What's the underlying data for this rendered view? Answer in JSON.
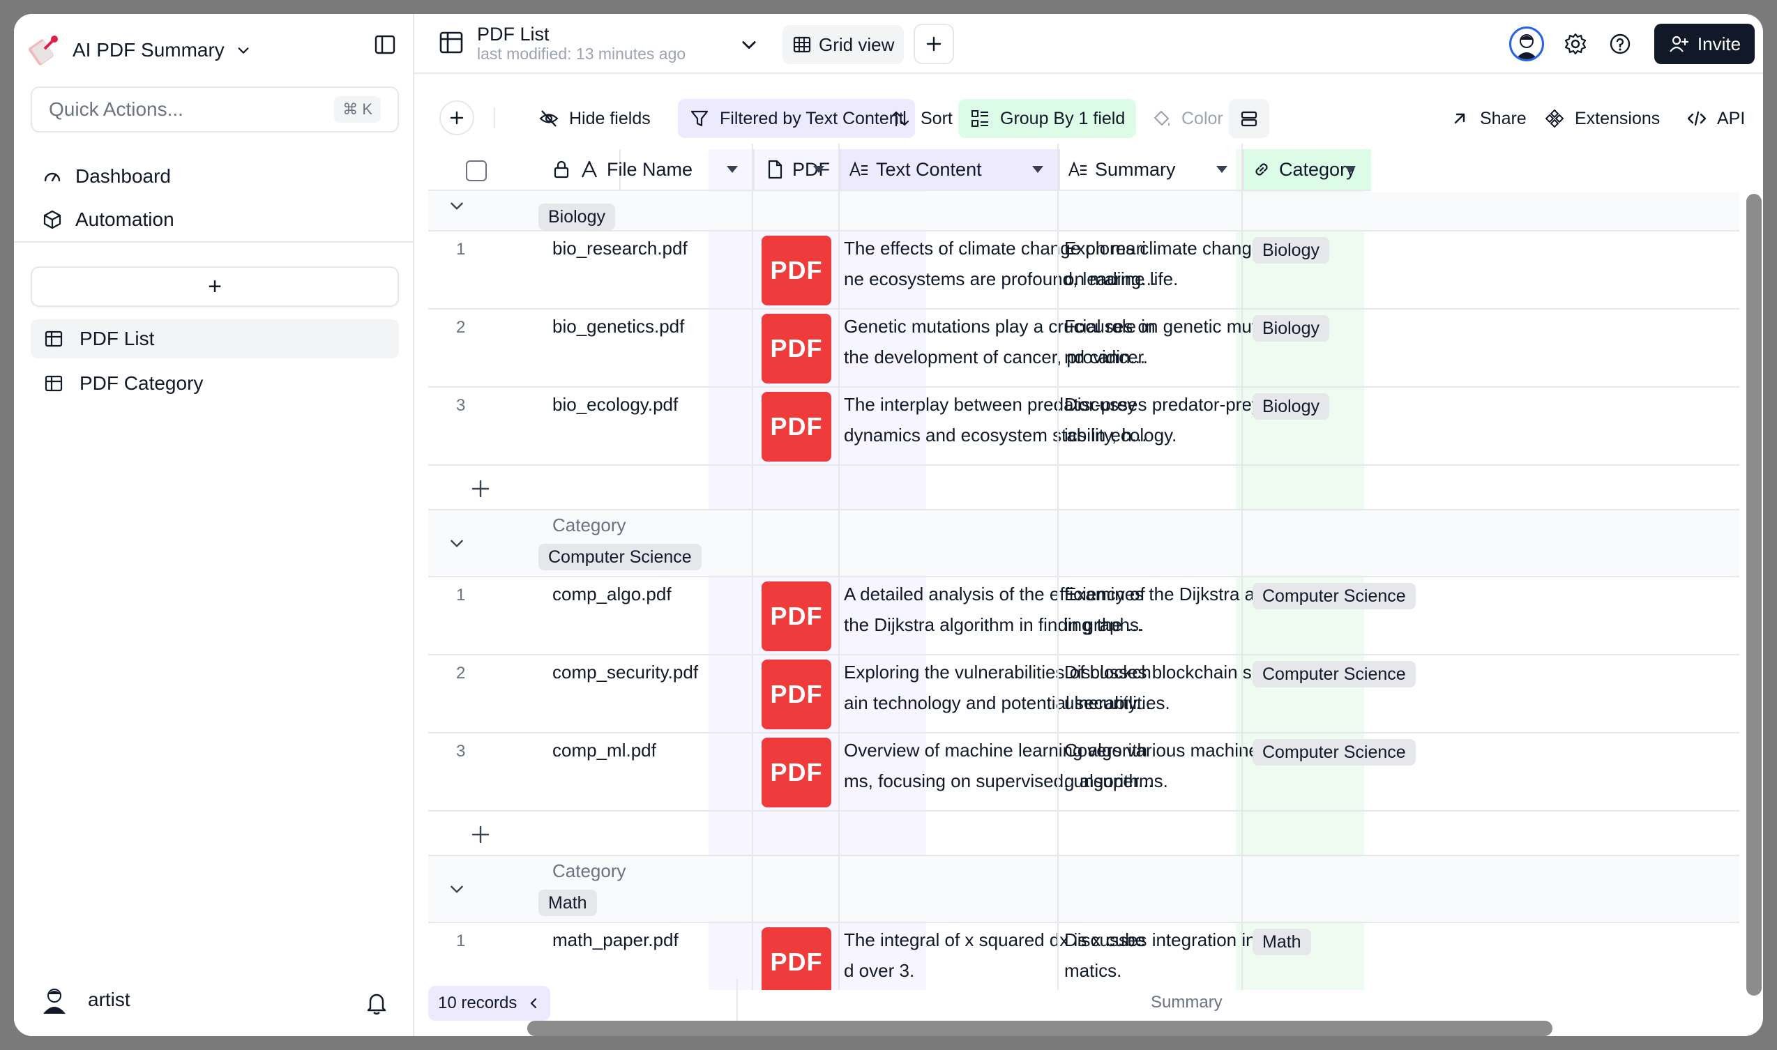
{
  "sidebar": {
    "app_title": "AI PDF Summary",
    "quick_actions_placeholder": "Quick Actions...",
    "quick_actions_shortcut": "⌘ K",
    "nav": [
      {
        "label": "Dashboard",
        "icon": "gauge-icon"
      },
      {
        "label": "Automation",
        "icon": "cube-icon"
      }
    ],
    "add_table_label": "+",
    "tables": [
      {
        "label": "PDF List",
        "active": true
      },
      {
        "label": "PDF Category",
        "active": false
      }
    ],
    "user_name": "artist"
  },
  "header": {
    "table_name": "PDF List",
    "last_modified": "last modified: 13 minutes ago",
    "view_name": "Grid view",
    "invite_label": "Invite"
  },
  "toolbar": {
    "hide_fields": "Hide fields",
    "filter": "Filtered by Text Content",
    "sort": "Sort",
    "group": "Group By 1 field",
    "color": "Color",
    "share": "Share",
    "extensions": "Extensions",
    "api": "API"
  },
  "columns": {
    "file_name": "File Name",
    "pdf": "PDF",
    "text_content": "Text Content",
    "summary": "Summary",
    "category": "Category"
  },
  "group_label": "Category",
  "pdf_thumb_text": "PDF",
  "groups": [
    {
      "name": "Biology",
      "rows": [
        {
          "n": "1",
          "file": "bio_research.pdf",
          "text1": "The effects of climate change on mari",
          "text2": "ne ecosystems are profound, leading...",
          "sum1": "Explores climate change impact",
          "sum2": "on marine life.",
          "cat": "Biology"
        },
        {
          "n": "2",
          "file": "bio_genetics.pdf",
          "text1": "Genetic mutations play a crucial role in",
          "text2": " the development of cancer, providin...",
          "sum1": "Focuses on genetic mutations a",
          "sum2": "nd cancer.",
          "cat": "Biology"
        },
        {
          "n": "3",
          "file": "bio_ecology.pdf",
          "text1": "The interplay between predator-prey",
          "text2": "dynamics and ecosystem stability, h...",
          "sum1": "Discusses predator-prey dynam",
          "sum2": "ics in ecology.",
          "cat": "Biology"
        }
      ]
    },
    {
      "name": "Computer Science",
      "rows": [
        {
          "n": "1",
          "file": "comp_algo.pdf",
          "text1": "A detailed analysis of the efficiency of",
          "text2": " the Dijkstra algorithm in finding the ...",
          "sum1": "Examines the Dijkstra algorithm",
          "sum2": "in graphs.",
          "cat": "Computer Science"
        },
        {
          "n": "2",
          "file": "comp_security.pdf",
          "text1": "Exploring the vulnerabilities of blockch",
          "text2": "ain technology and potential security...",
          "sum1": "Discusses blockchain security v",
          "sum2": "ulnerabilities.",
          "cat": "Computer Science"
        },
        {
          "n": "3",
          "file": "comp_ml.pdf",
          "text1": "Overview of machine learning algorith",
          "text2": "ms, focusing on supervised, unsuper...",
          "sum1": "Covers various machine learnin",
          "sum2": "g algorithms.",
          "cat": "Computer Science"
        }
      ]
    },
    {
      "name": "Math",
      "rows": [
        {
          "n": "1",
          "file": "math_paper.pdf",
          "text1": "The integral of x squared dx is x cube",
          "text2": "d over 3.",
          "sum1": "Discusses integration in mathe",
          "sum2": "matics.",
          "cat": "Math"
        }
      ]
    }
  ],
  "footer": {
    "records": "10 records",
    "summary_label": "Summary"
  },
  "colors": {
    "accent_violet": "#ede9fe",
    "accent_green": "#dcfce7",
    "pdf_red": "#ef3b3b",
    "invite_bg": "#111827"
  }
}
